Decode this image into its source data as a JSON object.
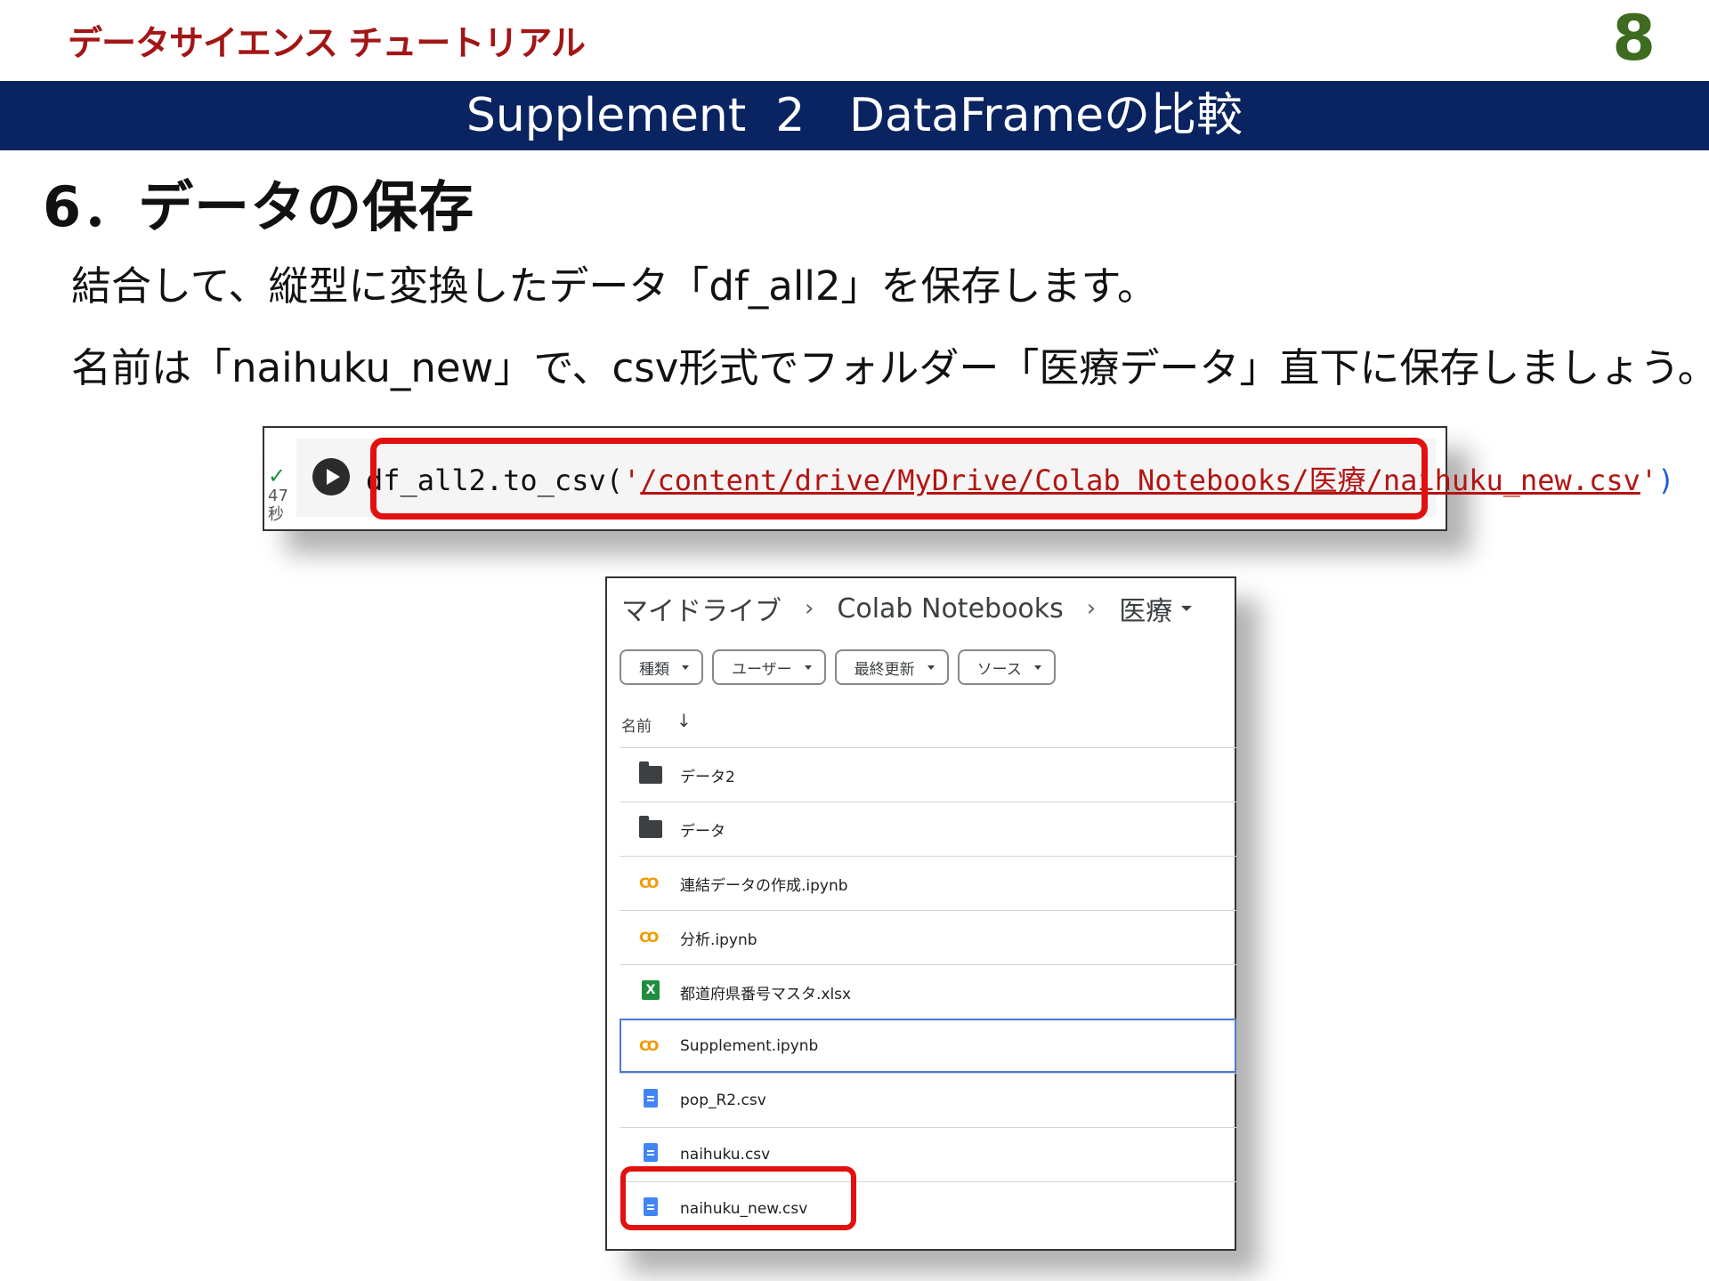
{
  "header": {
    "brand": "データサイエンス チュートリアル",
    "page_number": "8",
    "banner_title": "Supplement  2   DataFrameの比較"
  },
  "section": {
    "heading": "6．データの保存",
    "line1": "結合して、縦型に変換したデータ「df_all2」を保存します。",
    "line2": "名前は「naihuku_new」で、csv形式でフォルダー「医療データ」直下に保存しましょう。"
  },
  "cell": {
    "status_check": "✓",
    "exec_time": "47秒",
    "code_prefix": "df_all2.to_csv(",
    "quote_open": "'",
    "path": "/content/drive/MyDrive/Colab Notebooks/医療/naihuku_new.csv",
    "quote_close": "'",
    "code_suffix": ")"
  },
  "drive": {
    "breadcrumbs": [
      "マイドライブ",
      "Colab Notebooks",
      "医療"
    ],
    "filters": [
      "種類",
      "ユーザー",
      "最終更新",
      "ソース"
    ],
    "column_header": "名前",
    "sort_arrow": "↓",
    "files": [
      {
        "name": "データ2",
        "icon": "folder-icon"
      },
      {
        "name": "データ",
        "icon": "folder-icon"
      },
      {
        "name": "連結データの作成.ipynb",
        "icon": "colab-icon"
      },
      {
        "name": "分析.ipynb",
        "icon": "colab-icon"
      },
      {
        "name": "都道府県番号マスタ.xlsx",
        "icon": "excel-icon"
      },
      {
        "name": "Supplement.ipynb",
        "icon": "colab-icon"
      },
      {
        "name": "pop_R2.csv",
        "icon": "doc-icon"
      },
      {
        "name": "naihuku.csv",
        "icon": "doc-icon"
      },
      {
        "name": "naihuku_new.csv",
        "icon": "doc-icon"
      }
    ],
    "selected_index": 5,
    "highlighted_index": 8
  },
  "colors": {
    "brand": "#a31616",
    "page_number": "#3d6b1f",
    "banner": "#0a2461",
    "highlight": "#e31010"
  }
}
